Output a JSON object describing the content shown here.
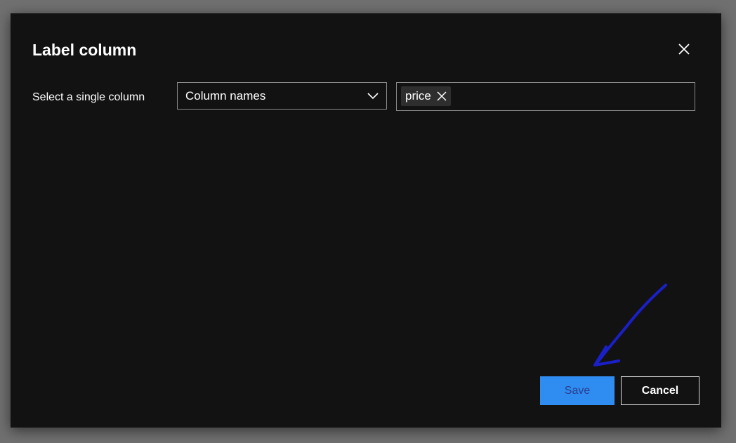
{
  "dialog": {
    "title": "Label column",
    "close_icon": "close-icon"
  },
  "column_selector": {
    "label": "Select a single column",
    "mode_dropdown": {
      "selected": "Column names",
      "icon": "chevron-down-icon"
    },
    "selected_columns": [
      {
        "label": "price",
        "remove_icon": "close-icon"
      }
    ]
  },
  "footer": {
    "save_label": "Save",
    "cancel_label": "Cancel"
  },
  "annotation": {
    "arrow_color": "#1a1fc8"
  },
  "colors": {
    "dialog_background": "#121212",
    "primary_button": "#2f8cf0",
    "backdrop": "#707070"
  }
}
